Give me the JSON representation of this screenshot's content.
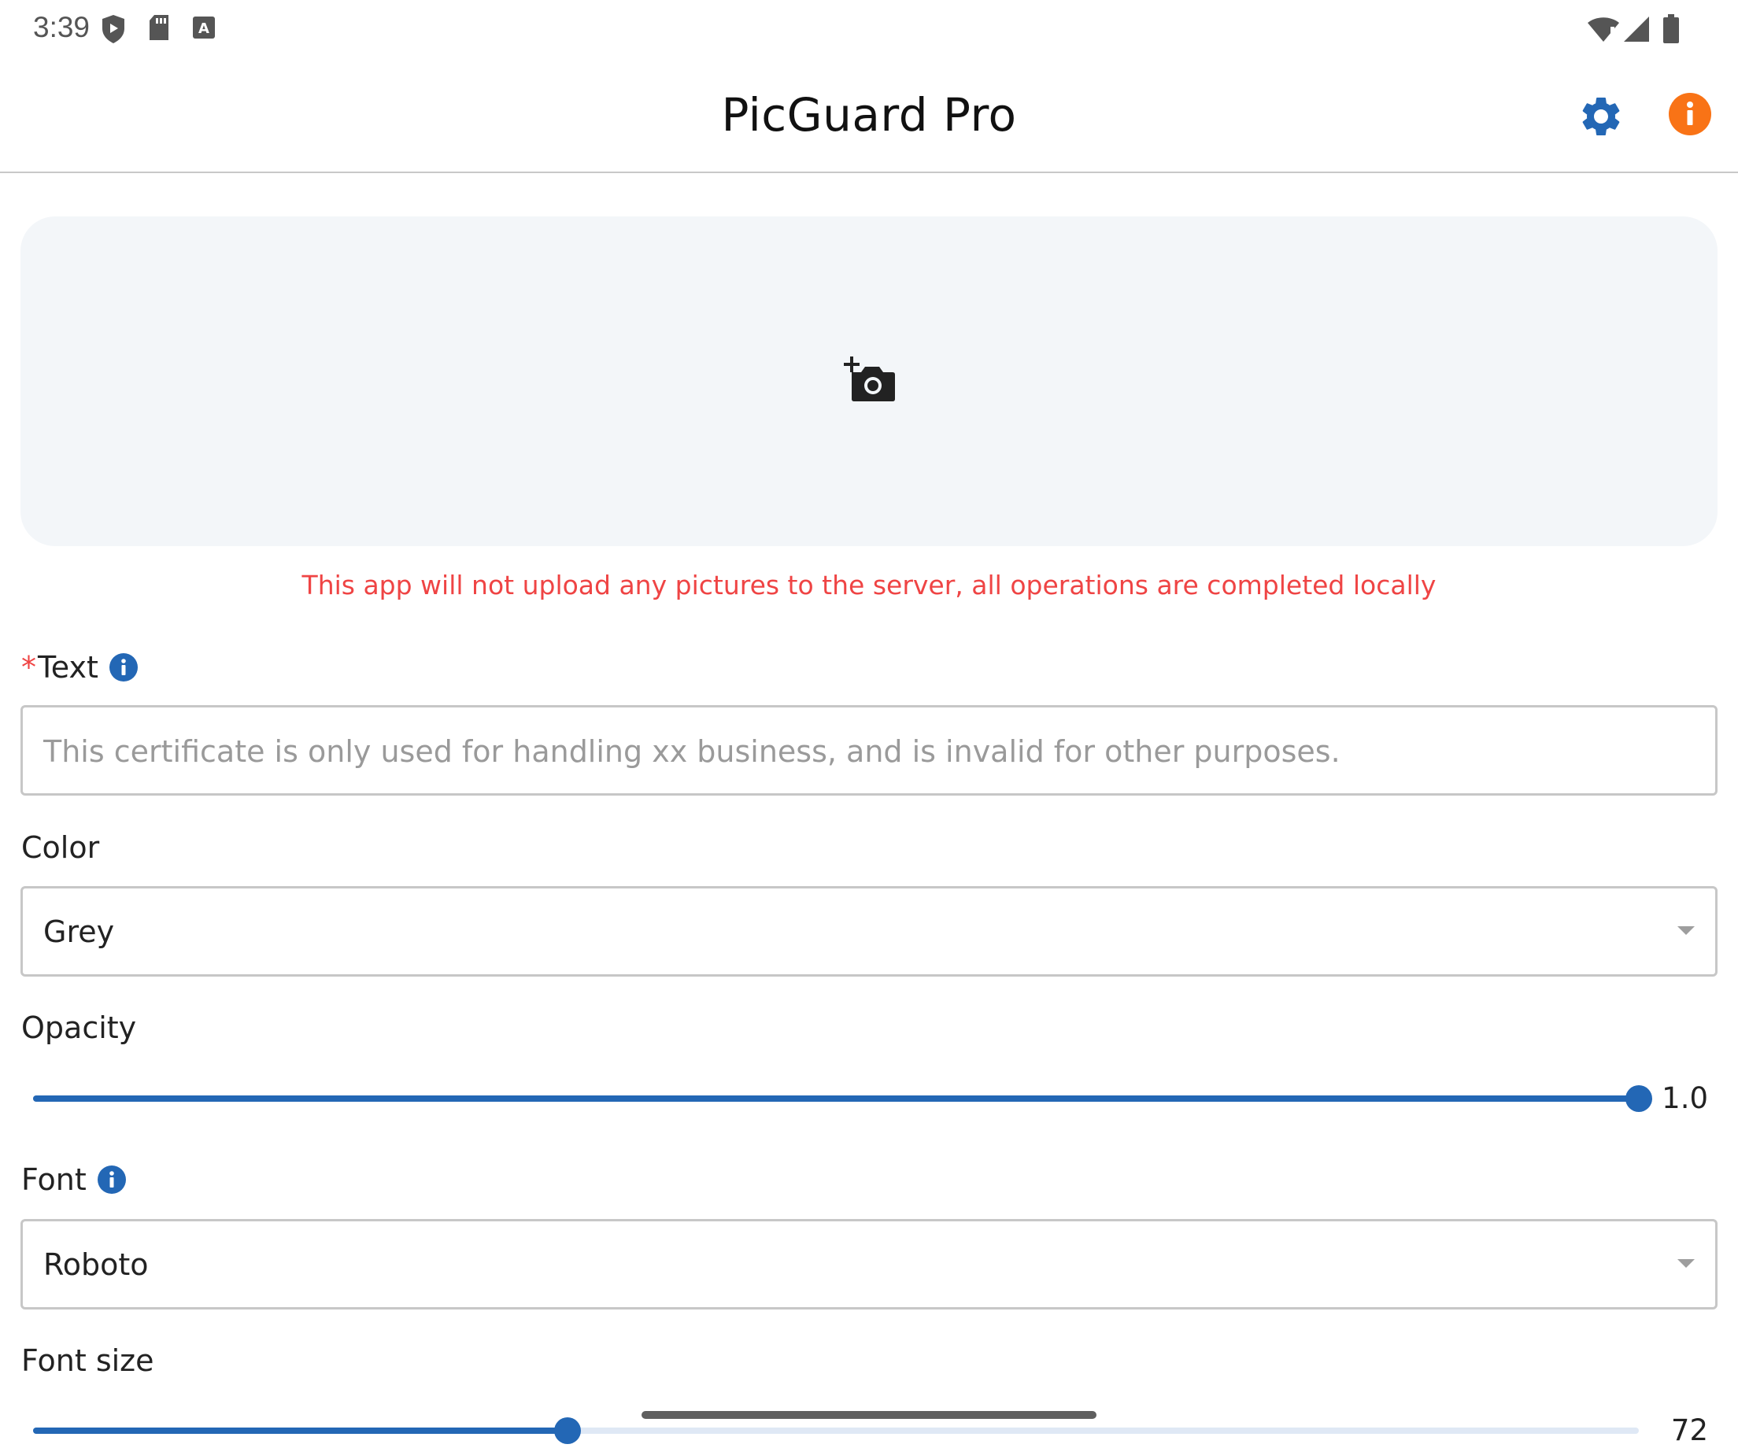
{
  "status_bar": {
    "time": "3:39",
    "left_icons": [
      "play-protect-icon",
      "sd-card-icon",
      "keyboard-a-icon"
    ],
    "right_icons": [
      "wifi-alert-icon",
      "cell-signal-icon",
      "battery-icon"
    ]
  },
  "app_bar": {
    "title": "PicGuard Pro",
    "settings_icon": "gear-icon",
    "info_icon": "info-icon",
    "settings_color": "#2367b5",
    "info_color": "#f97316"
  },
  "upload": {
    "icon": "add-photo-camera-icon",
    "privacy_note": "This app will not upload any pictures to the server, all operations are completed locally"
  },
  "form": {
    "text": {
      "required_mark": "*",
      "label": "Text",
      "placeholder": "This certificate is only used for handling xx business, and is invalid for other purposes.",
      "value": ""
    },
    "color": {
      "label": "Color",
      "selected": "Grey"
    },
    "opacity": {
      "label": "Opacity",
      "value_text": "1.0",
      "fraction": 1.0
    },
    "font": {
      "label": "Font",
      "selected": "Roboto"
    },
    "font_size": {
      "label": "Font size",
      "value_text": "72",
      "fraction": 0.333
    }
  },
  "colors": {
    "accent": "#2367b5",
    "warning_text": "#ef4444",
    "upload_bg": "#f3f6f9"
  }
}
